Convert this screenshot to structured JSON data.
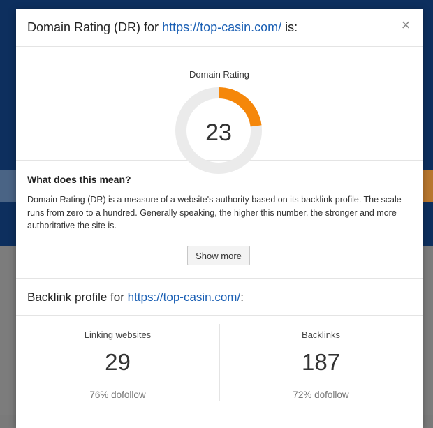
{
  "modal": {
    "title_prefix": "Domain Rating (DR) for ",
    "title_url": "https://top-casin.com/",
    "title_suffix": " is:",
    "close_glyph": "×"
  },
  "rating": {
    "label": "Domain Rating",
    "value": "23",
    "fraction": 0.23,
    "arc_color": "#f5870a",
    "track_color": "#ebebeb"
  },
  "meaning": {
    "title": "What does this mean?",
    "text": "Domain Rating (DR) is a measure of a website's authority based on its backlink profile. The scale runs from zero to a hundred. Generally speaking, the higher this number, the stronger and more authoritative the site is.",
    "show_more_label": "Show more"
  },
  "backlink_profile": {
    "title_prefix": "Backlink profile for ",
    "title_url": "https://top-casin.com/",
    "title_suffix": ":"
  },
  "stats": {
    "linking_websites": {
      "label": "Linking websites",
      "value": "29",
      "sub": "76% dofollow"
    },
    "backlinks": {
      "label": "Backlinks",
      "value": "187",
      "sub": "72% dofollow"
    }
  },
  "colors": {
    "link": "#1a5fb4",
    "background_page": "#0d2f5e"
  }
}
